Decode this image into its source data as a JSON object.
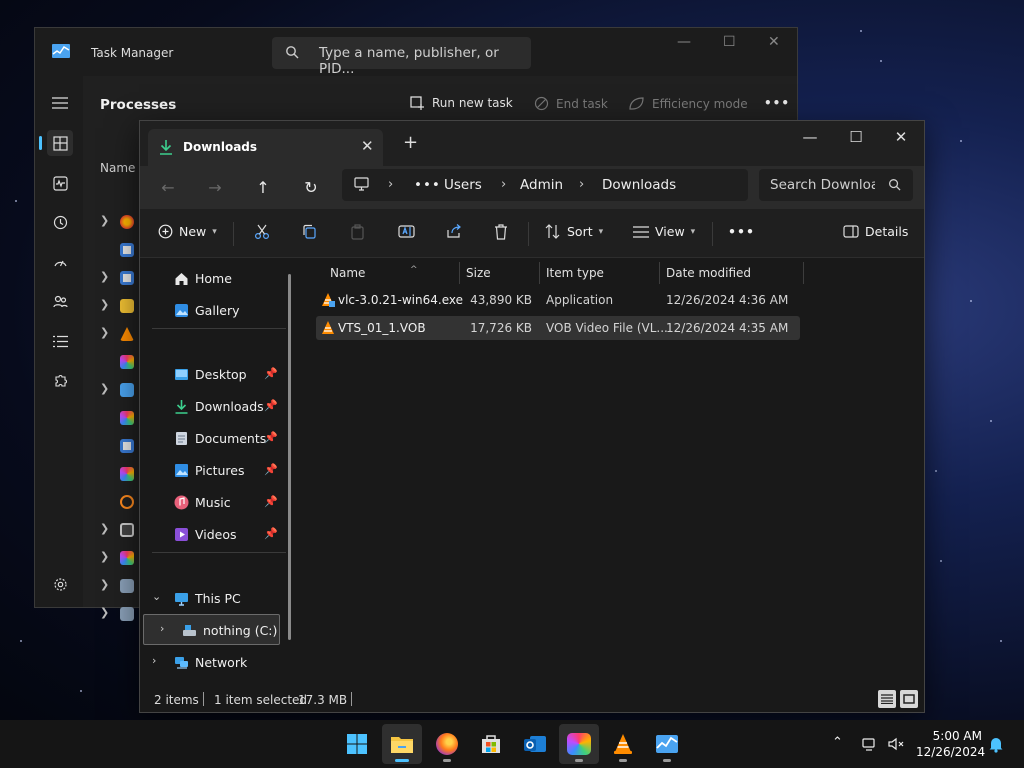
{
  "task_manager": {
    "title": "Task Manager",
    "search_placeholder": "Type a name, publisher, or PID...",
    "section_title": "Processes",
    "toolbar": {
      "run_new_task": "Run new task",
      "end_task": "End task",
      "efficiency_mode": "Efficiency mode",
      "more": "•••"
    },
    "column_name": "Name"
  },
  "explorer": {
    "tab_label": "Downloads",
    "breadcrumb": [
      "Users",
      "Admin",
      "Downloads"
    ],
    "breadcrumb_overflow": "•••",
    "search_placeholder": "Search Downloads",
    "commands": {
      "new": "New",
      "sort": "Sort",
      "view": "View",
      "more": "•••",
      "details": "Details"
    },
    "nav": {
      "home": "Home",
      "gallery": "Gallery",
      "quick_access": [
        "Desktop",
        "Downloads",
        "Documents",
        "Pictures",
        "Music",
        "Videos"
      ],
      "this_pc": "This PC",
      "drive": "nothing (C:)",
      "network": "Network"
    },
    "columns": {
      "name": "Name",
      "size": "Size",
      "type": "Item type",
      "date": "Date modified"
    },
    "files": [
      {
        "name": "vlc-3.0.21-win64.exe",
        "size": "43,890 KB",
        "type": "Application",
        "date": "12/26/2024 4:36 AM",
        "selected": false
      },
      {
        "name": "VTS_01_1.VOB",
        "size": "17,726 KB",
        "type": "VOB Video File (VL...",
        "date": "12/26/2024 4:35 AM",
        "selected": true
      }
    ],
    "status": {
      "items": "2 items",
      "selection": "1 item selected",
      "selection_size": "17.3 MB"
    }
  },
  "taskbar": {
    "time": "5:00 AM",
    "date": "12/26/2024"
  }
}
